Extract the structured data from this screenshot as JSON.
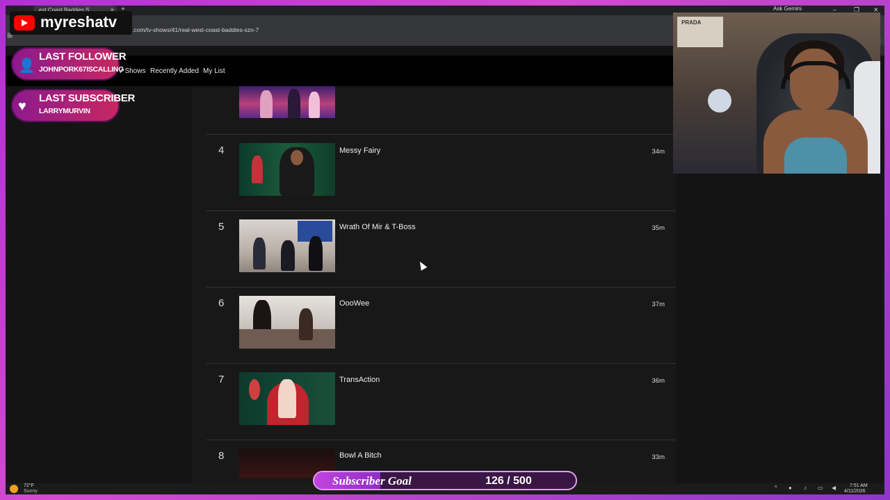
{
  "browser": {
    "tab_title": "est Coast Baddies S",
    "tab_close": "×",
    "new_tab": "+",
    "url": ".com/tv-shows/41/real-west-coast-baddies-szn-7",
    "ask_gemini": "Ask Gemini",
    "window_minimize": "–",
    "window_restore": "❐",
    "window_close": "✕"
  },
  "site_nav": {
    "items": [
      "V Shows",
      "Recently Added",
      "My List"
    ]
  },
  "episodes": [
    {
      "number": "",
      "title": "",
      "duration": ""
    },
    {
      "number": "4",
      "title": "Messy Fairy",
      "duration": "34m"
    },
    {
      "number": "5",
      "title": "Wrath Of Mir & T-Boss",
      "duration": "35m"
    },
    {
      "number": "6",
      "title": "OooWee",
      "duration": "37m"
    },
    {
      "number": "7",
      "title": "TransAction",
      "duration": "36m"
    },
    {
      "number": "8",
      "title": "Bowl A Bitch",
      "duration": "33m"
    }
  ],
  "overlay": {
    "channel": "myreshatv",
    "last_follower_title": "LAST FOLLOWER",
    "last_follower_name": "JOHNPORK67ISCALLING",
    "last_subscriber_title": "LAST SUBSCRIBER",
    "last_subscriber_name": "LARRYMURVIN",
    "subscriber_goal_label": "Subscriber Goal",
    "subscriber_goal_count": "126 / 500",
    "subscriber_goal_current": 126,
    "subscriber_goal_target": 500,
    "webcam_poster": "PRADA"
  },
  "taskbar": {
    "temperature": "72°F",
    "condition": "Sunny",
    "time": "7:51 AM",
    "date": "4/11/2026"
  },
  "colors": {
    "frame": "#b12fd6",
    "accent_red": "#ff0000"
  }
}
